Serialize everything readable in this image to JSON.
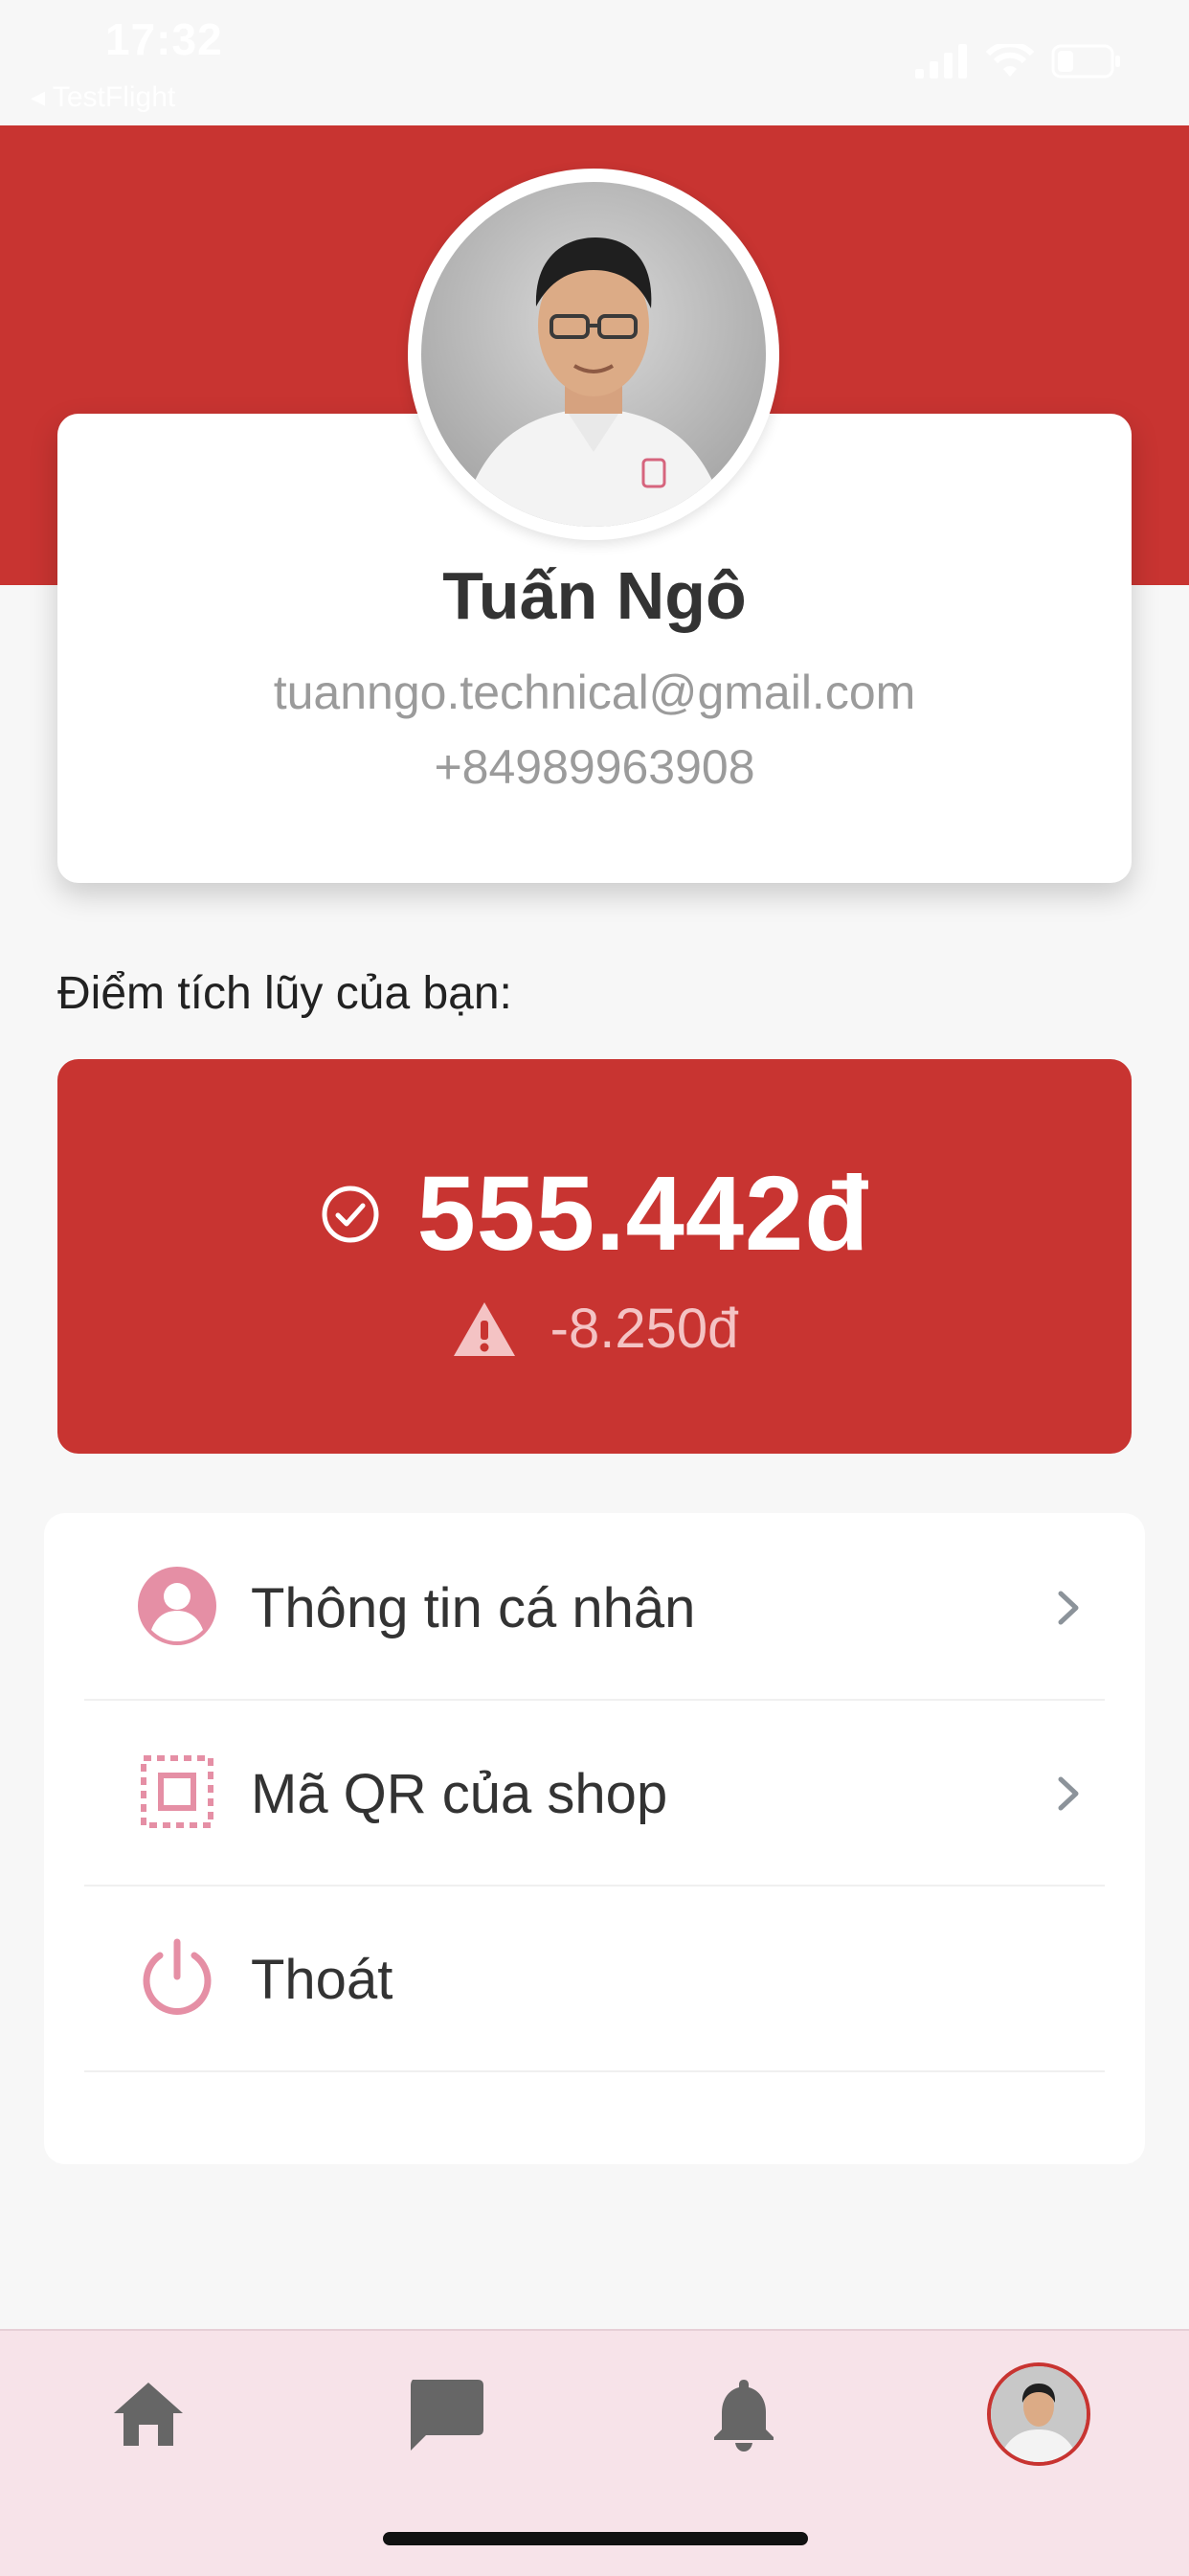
{
  "status_bar": {
    "time": "17:32",
    "back_app": "◂ TestFlight"
  },
  "profile": {
    "name": "Tuấn Ngô",
    "email": "tuanngo.technical@gmail.com",
    "phone": "+84989963908"
  },
  "points": {
    "label": "Điểm tích lũy của bạn:",
    "value": "555.442đ",
    "change": "-8.250đ"
  },
  "menu": {
    "items": [
      {
        "label": "Thông tin cá nhân",
        "icon": "user-circle-icon",
        "has_chevron": true
      },
      {
        "label": "Mã QR của shop",
        "icon": "qr-scan-icon",
        "has_chevron": true
      },
      {
        "label": "Thoát",
        "icon": "power-icon",
        "has_chevron": false
      }
    ]
  },
  "bottom_nav": {
    "items": [
      "home-icon",
      "chat-icon",
      "bell-icon",
      "profile-avatar"
    ],
    "active": "profile-avatar"
  },
  "colors": {
    "brand_red": "#c83431",
    "icon_pink": "#e58fa5",
    "nav_bg": "#f7e3e9",
    "nav_icon": "#666666"
  }
}
